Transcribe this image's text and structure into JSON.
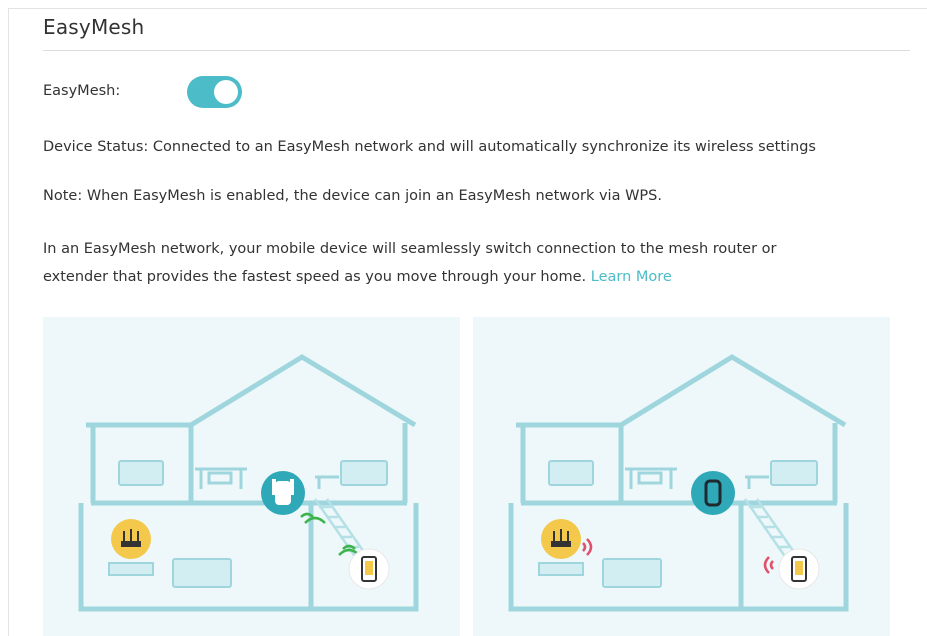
{
  "section": {
    "title": "EasyMesh"
  },
  "toggle_row": {
    "label": "EasyMesh:",
    "enabled": true,
    "accent_color": "#4cbcc8"
  },
  "status": {
    "text": "Device Status: Connected to an EasyMesh network and will automatically synchronize its wireless settings"
  },
  "note": {
    "text": "Note: When EasyMesh is enabled, the device can join an EasyMesh network via WPS."
  },
  "description": {
    "line1": "In an EasyMesh network, your mobile device will seamlessly switch connection to the mesh router or",
    "line2": "extender that provides the fastest speed as you move through your home.",
    "link": "Learn More"
  },
  "illustrations": [
    {
      "name": "house-illustration-extender",
      "extender_icon": "extender-icon",
      "router_icon": "router-icon",
      "phone_icon": "phone-icon",
      "active_signal_color": "#3cb44b"
    },
    {
      "name": "house-illustration-router",
      "extender_icon": "extender-icon",
      "router_icon": "router-icon",
      "phone_icon": "phone-icon",
      "active_signal_color": "#e0506a"
    }
  ]
}
